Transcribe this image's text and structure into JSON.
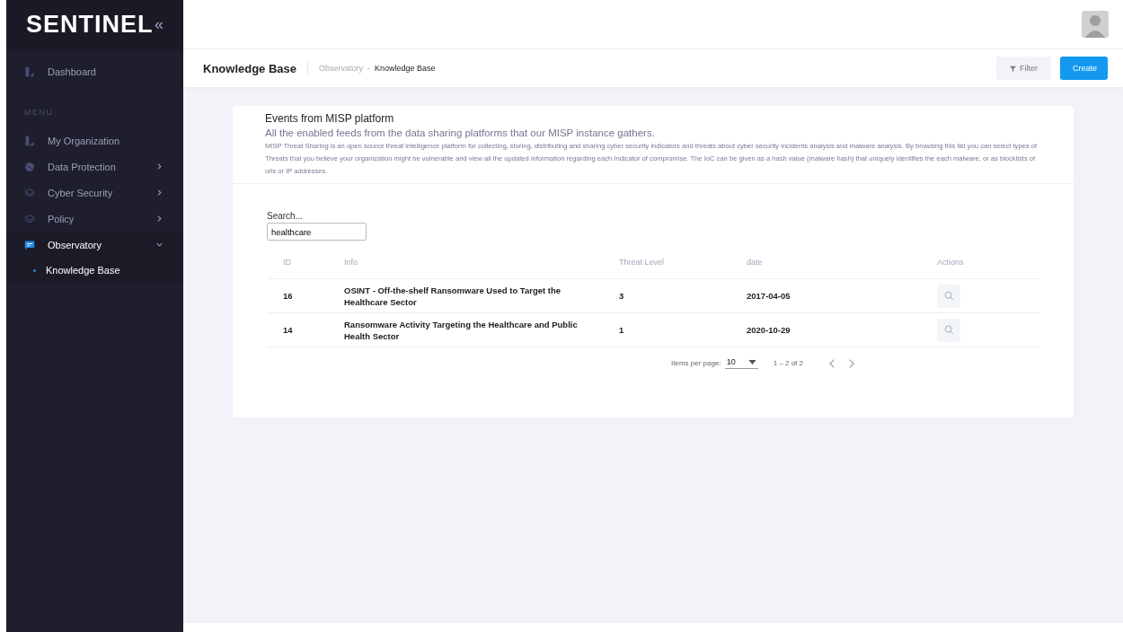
{
  "sidebar": {
    "logo": "SENTINEL",
    "collapse": "«",
    "top_items": [
      {
        "label": "Dashboard",
        "selected": false
      }
    ],
    "section": "MENU",
    "items": [
      {
        "label": "My Organization",
        "kind": "link",
        "selected": false
      },
      {
        "label": "Data Protection",
        "kind": "group",
        "expanded": false,
        "selected": false
      },
      {
        "label": "Cyber Security",
        "kind": "group",
        "expanded": false,
        "selected": false
      },
      {
        "label": "Policy",
        "kind": "group",
        "expanded": false,
        "selected": false
      },
      {
        "label": "Observatory",
        "kind": "group",
        "expanded": true,
        "selected": true,
        "children": [
          {
            "label": "Knowledge Base",
            "selected": true
          }
        ]
      }
    ]
  },
  "page_header": {
    "title": "Knowledge Base",
    "breadcrumb": [
      "Observatory",
      "Knowledge Base"
    ],
    "breadcrumb_separator": "-",
    "buttons": [
      {
        "label": "Filter",
        "kind": "filter"
      },
      {
        "label": "Create",
        "kind": "primary"
      }
    ]
  },
  "card": {
    "title": "Events from MISP platform",
    "subtitle": "All the enabled feeds from the data sharing platforms that our MISP instance gathers.",
    "description": "MISP Threat Sharing is an open source threat intelligence platform for collecting, storing, distributing and sharing cyber security indicators and threats about cyber security incidents analysis and malware analysis. By browsing this list you can select types of Threats that you believe your organization might be vulnerable and view all the updated information regarding each Indicator of compromise. The IoC can be given as a hash value (malware hash) that uniquely identifies the each malware, or as blocklists of urls or IP addresses.",
    "search": {
      "label": "Search...",
      "value": "healthcare"
    },
    "table": {
      "columns": [
        "ID",
        "Info",
        "Threat Level",
        "date",
        "Actions"
      ],
      "rows": [
        {
          "id": "16",
          "info": "OSINT - Off-the-shelf Ransomware Used to Target the Healthcare Sector",
          "threat_level": "3",
          "date": "2017-04-05"
        },
        {
          "id": "14",
          "info": "Ransomware Activity Targeting the Healthcare and Public Health Sector",
          "threat_level": "1",
          "date": "2020-10-29"
        }
      ]
    },
    "pagination": {
      "items_per_page_label": "Items per page:",
      "items_per_page": "10",
      "range": "1 – 2 of 2"
    }
  }
}
